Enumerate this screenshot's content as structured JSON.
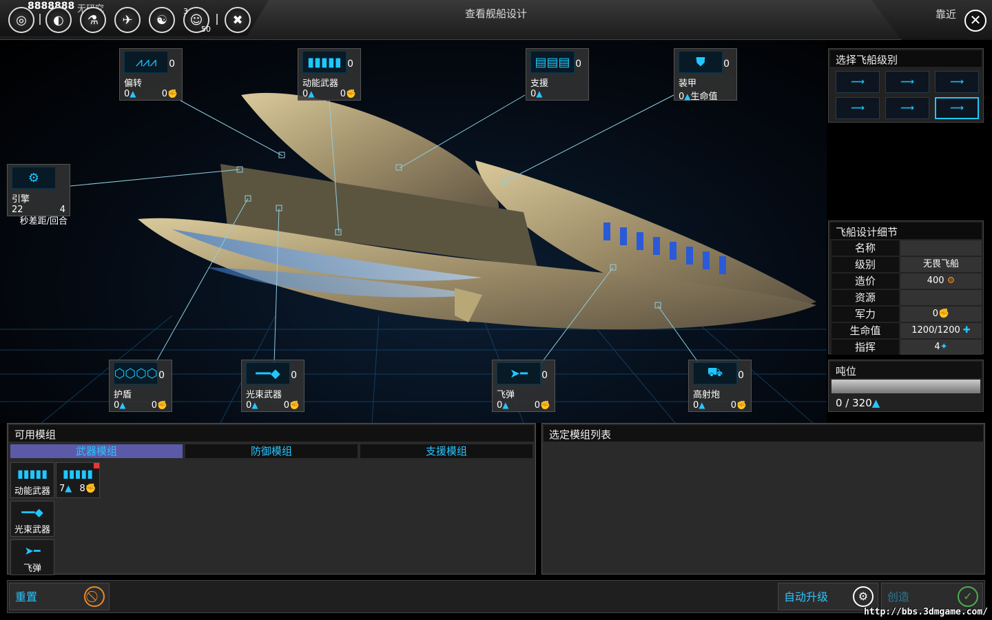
{
  "topbar": {
    "money": "8888888",
    "research": "无研究",
    "counter_a": "3",
    "counter_b": "50",
    "icons": [
      "empire-icon",
      "planets-icon",
      "science-icon",
      "fleet-icon",
      "diplomacy-icon",
      "population-icon",
      "tools-icon"
    ]
  },
  "page_title": "查看舰船设计",
  "zoom_label": "靠近",
  "close_label": "✕",
  "slots": {
    "deflector": {
      "name": "偏转",
      "count": "0",
      "a": "0",
      "b": "0"
    },
    "kinetic": {
      "name": "动能武器",
      "count": "0",
      "a": "0",
      "b": "0"
    },
    "support": {
      "name": "支援",
      "count": "0",
      "a": "0"
    },
    "armor": {
      "name": "装甲",
      "count": "0",
      "a": "0",
      "hp_label": "生命值"
    },
    "engine": {
      "name": "引擎",
      "speed": "22",
      "range": "4",
      "unit": "秒差距/回合"
    },
    "shield": {
      "name": "护盾",
      "count": "0",
      "a": "0",
      "b": "0"
    },
    "beam": {
      "name": "光束武器",
      "count": "0",
      "a": "0",
      "b": "0"
    },
    "missile": {
      "name": "飞弹",
      "count": "0",
      "a": "0",
      "b": "0"
    },
    "flak": {
      "name": "高射炮",
      "count": "0",
      "a": "0",
      "b": "0"
    }
  },
  "class_panel": {
    "title": "选择飞船级别"
  },
  "details": {
    "title": "飞船设计细节",
    "rows": [
      {
        "label": "名称",
        "value": ""
      },
      {
        "label": "级别",
        "value": "无畏飞船"
      },
      {
        "label": "造价",
        "value": "400"
      },
      {
        "label": "资源",
        "value": ""
      },
      {
        "label": "军力",
        "value": "0"
      },
      {
        "label": "生命值",
        "value": "1200/1200"
      },
      {
        "label": "指挥",
        "value": "4"
      }
    ]
  },
  "tonnage": {
    "title": "吨位",
    "value": "0 / 320",
    "fill": 0
  },
  "available": {
    "title": "可用模组",
    "tabs": [
      "武器模组",
      "防御模组",
      "支援模组"
    ],
    "active_tab": 0,
    "modules": [
      {
        "name": "动能武器"
      },
      {
        "name": "",
        "a": "7",
        "b": "8"
      },
      {
        "name": "光束武器"
      },
      {
        "name": "飞弹"
      }
    ]
  },
  "selected_list": {
    "title": "选定模组列表"
  },
  "actions": {
    "reset": "重置",
    "auto_upgrade": "自动升级",
    "create": "创造"
  },
  "watermark": "http://bbs.3dmgame.com/",
  "colors": {
    "accent": "#29c5ff",
    "tab_active": "#5b5aa8",
    "reset": "#f08a24",
    "create": "#4caf50"
  }
}
